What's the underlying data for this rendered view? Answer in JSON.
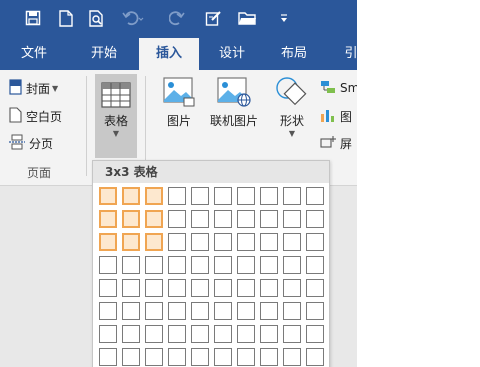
{
  "qat": {
    "icons": [
      "save-icon",
      "new-document-icon",
      "print-preview-icon",
      "undo-icon",
      "redo-icon",
      "edit-icon",
      "open-folder-icon",
      "customize-quick-access-icon"
    ]
  },
  "tabs": [
    {
      "label": "文件",
      "active": false
    },
    {
      "label": "开始",
      "active": false
    },
    {
      "label": "插入",
      "active": true
    },
    {
      "label": "设计",
      "active": false
    },
    {
      "label": "布局",
      "active": false
    },
    {
      "label": "引",
      "active": false
    }
  ],
  "ribbon": {
    "pages_group": {
      "cover_label": "封面",
      "blank_page_label": "空白页",
      "page_break_label": "分页",
      "group_label": "页面"
    },
    "table_button_label": "表格",
    "picture_label": "图片",
    "online_picture_label": "联机图片",
    "shapes_label": "形状",
    "smartart_label": "Sm",
    "chart_label": "图",
    "screenshot_label": "屏"
  },
  "table_dropdown": {
    "header": "3x3  表格",
    "rows": 8,
    "cols": 10,
    "selected_rows": 3,
    "selected_cols": 3,
    "accent_color": "#f0a552",
    "accent_fill": "#fde8cf"
  },
  "colors": {
    "title_bar": "#2b579a",
    "ribbon": "#f3f3f3"
  }
}
